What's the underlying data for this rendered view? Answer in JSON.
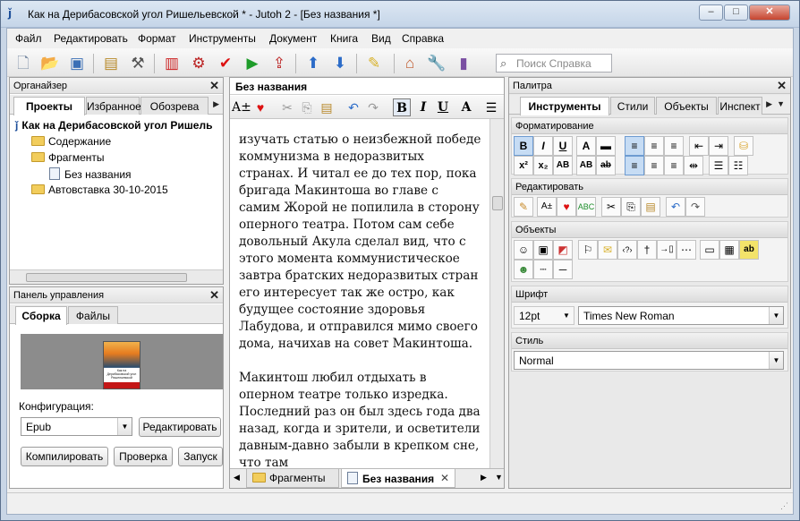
{
  "window": {
    "title": "Как на Дерибасовской угол Ришельевской * - Jutoh 2 - [Без названия *]",
    "app_icon": "jutoh-icon"
  },
  "menu": [
    "Файл",
    "Редактировать",
    "Формат",
    "Инструменты",
    "Документ",
    "Книга",
    "Вид",
    "Справка"
  ],
  "toolbar": {
    "search_placeholder": "Поиск Справка"
  },
  "organizer": {
    "title": "Органайзер",
    "tabs": [
      "Проекты",
      "Избранное",
      "Обозрева"
    ],
    "tree": {
      "root": "Как на Дерибасовской угол Ришель",
      "items": [
        "Содержание",
        "Фрагменты",
        "Без названия",
        "Автовставка 30-10-2015"
      ]
    }
  },
  "control_panel": {
    "title": "Панель управления",
    "tabs": [
      "Сборка",
      "Файлы"
    ],
    "config_label": "Конфигурация:",
    "config_value": "Epub",
    "edit_button": "Редактировать",
    "compile_button": "Компилировать",
    "check_button": "Проверка",
    "run_button": "Запуск",
    "cover_text": "Как на Дерибасовской угол Ришельевской"
  },
  "editor": {
    "title": "Без названия",
    "paragraphs": [
      "изучать статью о неизбежной победе коммунизма в недоразвитых странах. И читал ее до тех пор, пока бригада Макинтоша во главе с самим Жорой не попилила в сторону оперного театра. Потом сам себе довольный Акула сделал вид, что с этого момента коммунистическое завтра братских недоразвитых стран его интересует так же остро, как будущее состояние здоровья Лабудова, и отправился мимо своего дома, начихав на совет Макинтоша.",
      "Макинтош любил отдыхать в оперном театре только изредка. Последний раз он был здесь года два назад, когда и зрители, и осветители давным-давно забыли в крепком сне, что там"
    ],
    "bottom_tabs": [
      "Фрагменты",
      "Без названия"
    ]
  },
  "palette": {
    "title": "Палитра",
    "tabs": [
      "Инструменты",
      "Стили",
      "Объекты",
      "Инспект"
    ],
    "sections": {
      "formatting": "Форматирование",
      "editing": "Редактировать",
      "objects": "Объекты",
      "font": "Шрифт",
      "style": "Стиль"
    },
    "font_size": "12pt",
    "font_name": "Times New Roman",
    "style_value": "Normal"
  },
  "colors": {
    "accent": "#3a78c8",
    "selected_button": "#c6dcf4"
  }
}
